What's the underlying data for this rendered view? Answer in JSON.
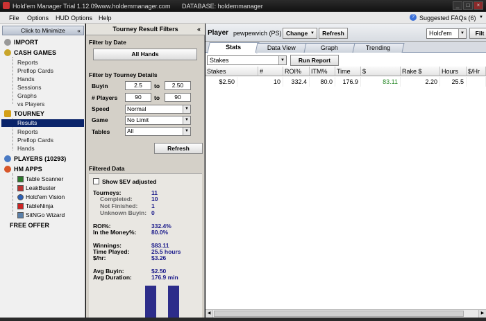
{
  "window": {
    "title": "Hold'em Manager Trial 1.12.09",
    "website": "www.holdemmanager.com",
    "database": "DATABASE: holdemmanager"
  },
  "menu": {
    "file": "File",
    "options": "Options",
    "hud_options": "HUD Options",
    "help": "Help",
    "faqs": "Suggested FAQs (6)"
  },
  "nav": {
    "minimize": "Click to Minimize",
    "import": "IMPORT",
    "cash_games": "CASH GAMES",
    "cash_items": [
      "Reports",
      "Preflop Cards",
      "Hands",
      "Sessions",
      "Graphs",
      "vs Players"
    ],
    "tourney": "TOURNEY",
    "tourney_items": [
      "Results",
      "Reports",
      "Preflop Cards",
      "Hands"
    ],
    "players": "PLAYERS (10293)",
    "hm_apps": "HM APPS",
    "apps": [
      "Table Scanner",
      "LeakBuster",
      "Hold'em Vision",
      "TableNinja",
      "SitNGo Wizard"
    ],
    "free_offer": "FREE OFFER"
  },
  "filters": {
    "title": "Tourney Result Filters",
    "by_date": "Filter by Date",
    "all_hands": "All Hands",
    "by_details": "Filter by Tourney Details",
    "buyin_label": "Buyin",
    "buyin_from": "2.5",
    "buyin_to": "2.50",
    "to1": "to",
    "players_label": "# Players",
    "players_from": "90",
    "players_to": "90",
    "to2": "to",
    "speed_label": "Speed",
    "speed": "Normal",
    "game_label": "Game",
    "game": "No Limit",
    "tables_label": "Tables",
    "tables": "All",
    "refresh": "Refresh",
    "filtered_data": "Filtered Data",
    "show_sev": "Show $EV adjusted",
    "tourneys_label": "Tourneys:",
    "tourneys": "11",
    "completed_label": "Completed:",
    "completed": "10",
    "not_finished_label": "Not Finished:",
    "not_finished": "1",
    "unknown_label": "Unknown Buyin:",
    "unknown": "0",
    "roi_label": "ROI%:",
    "roi": "332.4%",
    "itm_label": "In the Money%:",
    "itm": "80.0%",
    "winnings_label": "Winnings:",
    "winnings": "$83.11",
    "time_label": "Time Played:",
    "time": "25.5 hours",
    "hr_label": "$/hr:",
    "hr": "$3.26",
    "avg_buyin_label": "Avg Buyin:",
    "avg_buyin": "$2.50",
    "avg_dur_label": "Avg Duration:",
    "avg_dur": "176.9 min"
  },
  "main": {
    "player_label": "Player",
    "player_name": "pewpewvich (PS)",
    "change": "Change",
    "refresh": "Refresh",
    "game_select": "Hold'em",
    "filters_btn": "Filt",
    "tabs": [
      "Stats",
      "Data View",
      "Graph",
      "Trending"
    ],
    "report_select": "Stakes",
    "run_report": "Run Report",
    "columns": [
      "Stakes",
      "#",
      "ROI%",
      "ITM%",
      "Time",
      "$",
      "Rake $",
      "Hours",
      "$/Hr"
    ],
    "row": [
      "$2.50",
      "10",
      "332.4",
      "80.0",
      "176.9",
      "83.11",
      "2.20",
      "25.5",
      ""
    ],
    "win_color": "#2a8a2a"
  }
}
